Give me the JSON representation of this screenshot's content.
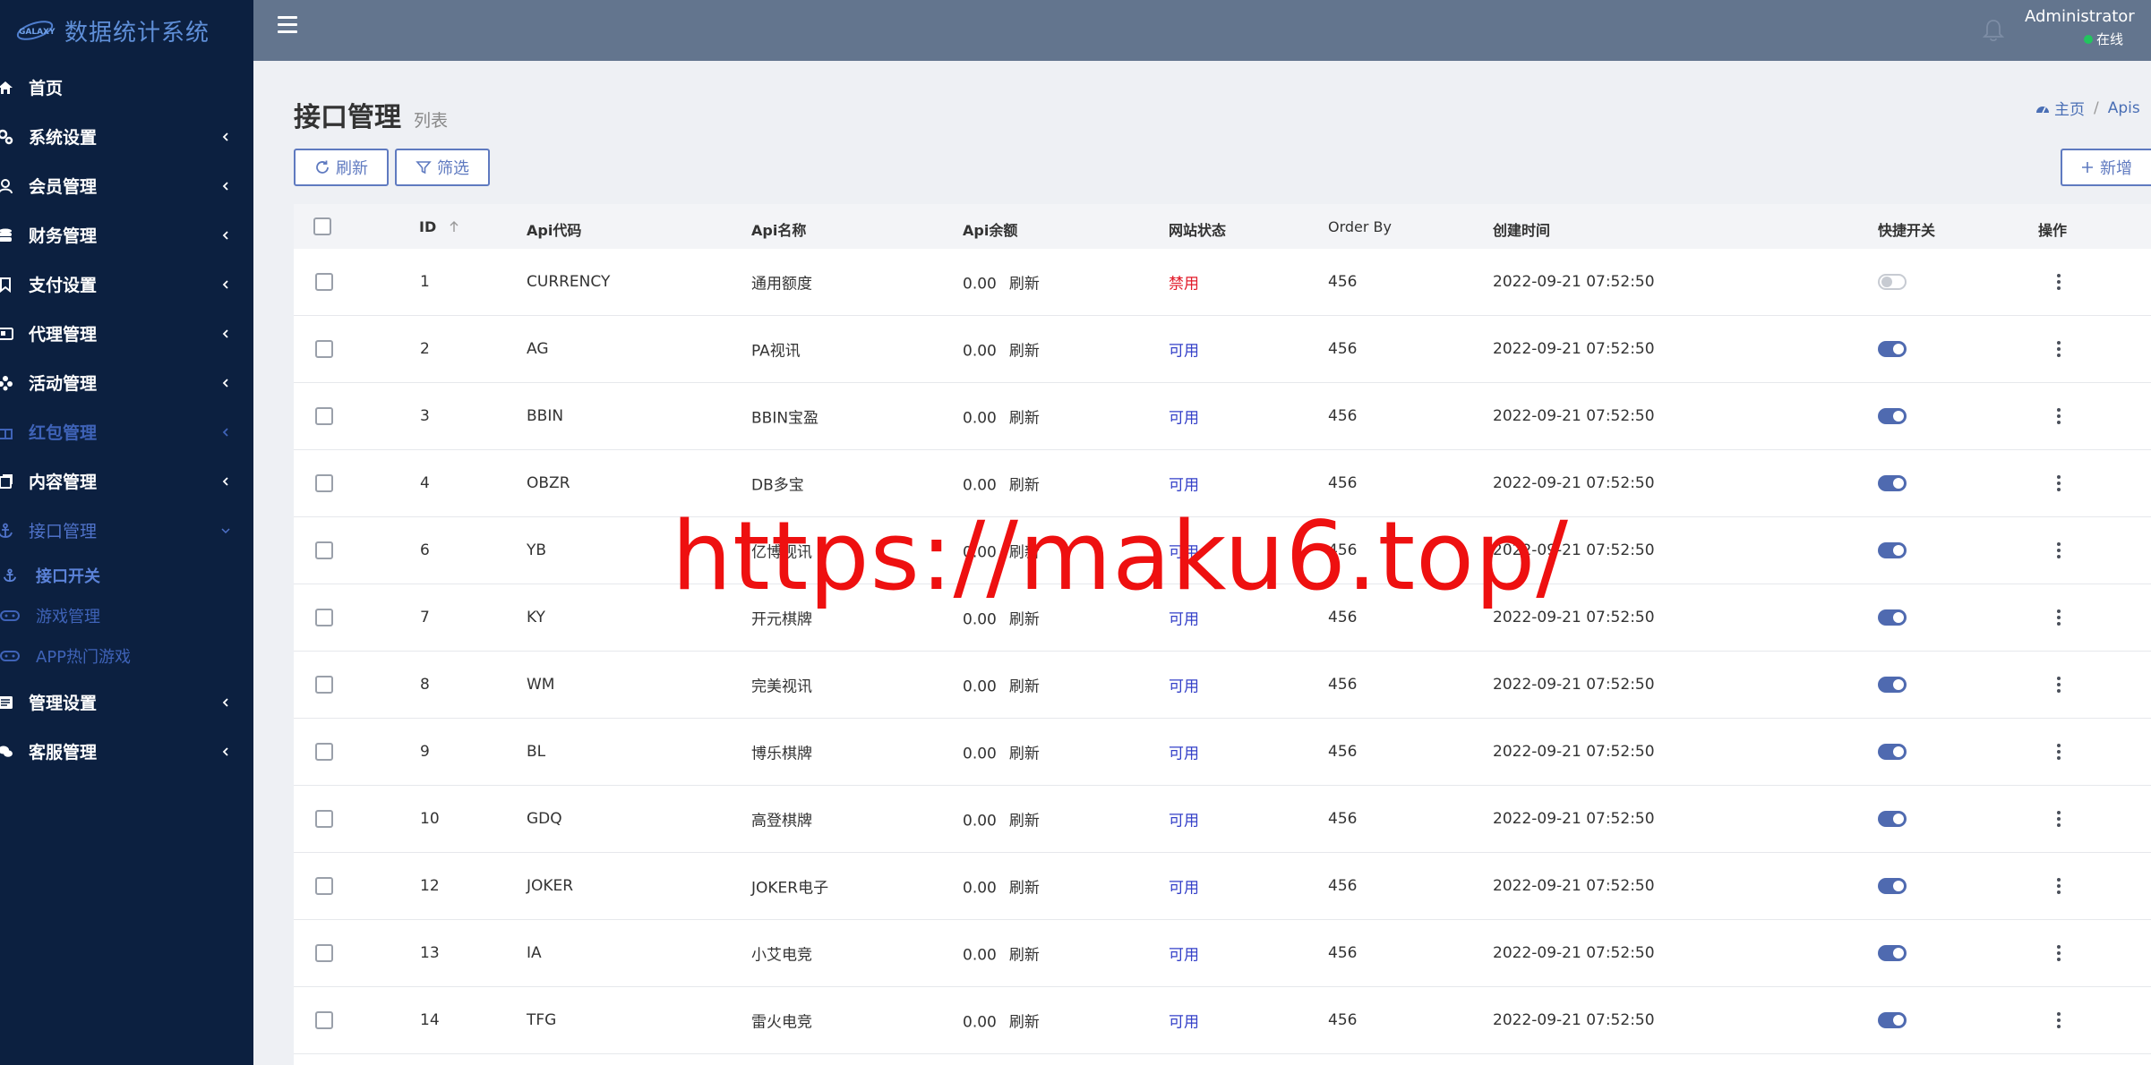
{
  "brand": {
    "title": "数据统计系统",
    "logo_text": "GALAXY"
  },
  "sidebar": {
    "items": [
      {
        "label": "首页",
        "icon": "home-icon"
      },
      {
        "label": "系统设置",
        "icon": "cogs-icon"
      },
      {
        "label": "会员管理",
        "icon": "user-icon"
      },
      {
        "label": "财务管理",
        "icon": "database-icon"
      },
      {
        "label": "支付设置",
        "icon": "bookmark-icon"
      },
      {
        "label": "代理管理",
        "icon": "id-card-icon"
      },
      {
        "label": "活动管理",
        "icon": "flower-icon"
      },
      {
        "label": "红包管理",
        "icon": "gift-icon"
      },
      {
        "label": "内容管理",
        "icon": "copy-icon"
      },
      {
        "label": "接口管理",
        "icon": "anchor-icon"
      },
      {
        "label": "管理设置",
        "icon": "list-alt-icon"
      },
      {
        "label": "客服管理",
        "icon": "comments-icon"
      }
    ],
    "submenu": [
      {
        "label": "接口开关",
        "icon": "anchor-icon"
      },
      {
        "label": "游戏管理",
        "icon": "gamepad-icon"
      },
      {
        "label": "APP热门游戏",
        "icon": "gamepad-icon"
      }
    ]
  },
  "header": {
    "user_name": "Administrator",
    "user_status": "在线"
  },
  "page": {
    "title": "接口管理",
    "subtitle": "列表"
  },
  "breadcrumb": {
    "home": "主页",
    "current": "Apis"
  },
  "toolbar": {
    "refresh_label": "刷新",
    "filter_label": "筛选",
    "add_label": "新增"
  },
  "table": {
    "headers": {
      "id": "ID",
      "code": "Api代码",
      "name": "Api名称",
      "balance": "Api余额",
      "status": "网站状态",
      "order_by": "Order By",
      "created": "创建时间",
      "switch": "快捷开关",
      "actions": "操作"
    },
    "refresh_link": "刷新",
    "rows": [
      {
        "id": "1",
        "code": "CURRENCY",
        "name": "通用额度",
        "balance": "0.00",
        "status": "禁用",
        "enabled": false,
        "order_by": "456",
        "created": "2022-09-21 07:52:50",
        "switch_on": false
      },
      {
        "id": "2",
        "code": "AG",
        "name": "PA视讯",
        "balance": "0.00",
        "status": "可用",
        "enabled": true,
        "order_by": "456",
        "created": "2022-09-21 07:52:50",
        "switch_on": true
      },
      {
        "id": "3",
        "code": "BBIN",
        "name": "BBIN宝盈",
        "balance": "0.00",
        "status": "可用",
        "enabled": true,
        "order_by": "456",
        "created": "2022-09-21 07:52:50",
        "switch_on": true
      },
      {
        "id": "4",
        "code": "OBZR",
        "name": "DB多宝",
        "balance": "0.00",
        "status": "可用",
        "enabled": true,
        "order_by": "456",
        "created": "2022-09-21 07:52:50",
        "switch_on": true
      },
      {
        "id": "6",
        "code": "YB",
        "name": "亿博视讯",
        "balance": "0.00",
        "status": "可用",
        "enabled": true,
        "order_by": "456",
        "created": "2022-09-21 07:52:50",
        "switch_on": true
      },
      {
        "id": "7",
        "code": "KY",
        "name": "开元棋牌",
        "balance": "0.00",
        "status": "可用",
        "enabled": true,
        "order_by": "456",
        "created": "2022-09-21 07:52:50",
        "switch_on": true
      },
      {
        "id": "8",
        "code": "WM",
        "name": "完美视讯",
        "balance": "0.00",
        "status": "可用",
        "enabled": true,
        "order_by": "456",
        "created": "2022-09-21 07:52:50",
        "switch_on": true
      },
      {
        "id": "9",
        "code": "BL",
        "name": "博乐棋牌",
        "balance": "0.00",
        "status": "可用",
        "enabled": true,
        "order_by": "456",
        "created": "2022-09-21 07:52:50",
        "switch_on": true
      },
      {
        "id": "10",
        "code": "GDQ",
        "name": "高登棋牌",
        "balance": "0.00",
        "status": "可用",
        "enabled": true,
        "order_by": "456",
        "created": "2022-09-21 07:52:50",
        "switch_on": true
      },
      {
        "id": "12",
        "code": "JOKER",
        "name": "JOKER电子",
        "balance": "0.00",
        "status": "可用",
        "enabled": true,
        "order_by": "456",
        "created": "2022-09-21 07:52:50",
        "switch_on": true
      },
      {
        "id": "13",
        "code": "IA",
        "name": "小艾电竞",
        "balance": "0.00",
        "status": "可用",
        "enabled": true,
        "order_by": "456",
        "created": "2022-09-21 07:52:50",
        "switch_on": true
      },
      {
        "id": "14",
        "code": "TFG",
        "name": "雷火电竞",
        "balance": "0.00",
        "status": "可用",
        "enabled": true,
        "order_by": "456",
        "created": "2022-09-21 07:52:50",
        "switch_on": true
      }
    ]
  },
  "watermark": "https://maku6.top/",
  "colors": {
    "sidebar_bg": "#0c2040",
    "header_bg": "#63758e",
    "accent": "#5f7ac0",
    "status_on": "#3440c8",
    "status_off": "#e21b2a"
  }
}
